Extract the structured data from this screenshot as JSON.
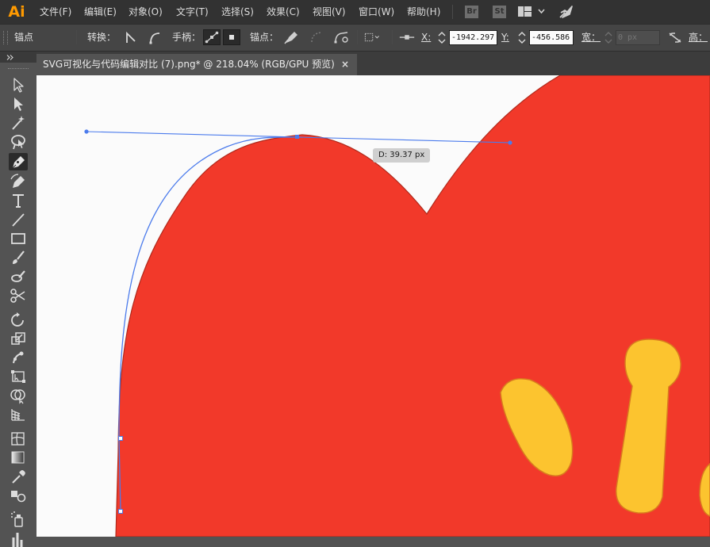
{
  "app": {
    "logo": "Ai"
  },
  "menu": {
    "items": [
      "文件(F)",
      "编辑(E)",
      "对象(O)",
      "文字(T)",
      "选择(S)",
      "效果(C)",
      "视图(V)",
      "窗口(W)",
      "帮助(H)"
    ],
    "bridge_label": "Br",
    "stock_label": "St",
    "accent_color": "#ff9a00"
  },
  "control_bar": {
    "anchor_section_label": "锚点",
    "convert_label": "转换：",
    "handles_label": "手柄：",
    "anchors_label": "锚点：",
    "x_label": "X:",
    "x_value": "-1942.297",
    "y_label": "Y:",
    "y_value": "-456.586",
    "width_label": "宽：",
    "width_value": "0 px",
    "height_label": "高："
  },
  "document": {
    "tab_title": "SVG可视化与代码编辑对比 (7).png* @ 218.04% (RGB/GPU 预览)",
    "close_glyph": "×"
  },
  "canvas": {
    "distance_tooltip": "D: 39.37 px",
    "path_color": "#4b7bec",
    "shape_fill": "#f2392a",
    "accent_fill": "#fcc42f"
  },
  "tools": [
    "selection-tool",
    "direct-selection-tool",
    "magic-wand-tool",
    "lasso-tool",
    "pen-tool",
    "curvature-tool",
    "type-tool",
    "line-segment-tool",
    "rectangle-tool",
    "paintbrush-tool",
    "shaper-tool",
    "scissors-tool",
    "rotate-tool",
    "scale-tool",
    "puppet-warp-tool",
    "free-transform-tool",
    "shape-builder-tool",
    "perspective-grid-tool",
    "mesh-tool",
    "gradient-tool",
    "eyedropper-tool",
    "blend-tool",
    "symbol-sprayer-tool",
    "column-graph-tool"
  ]
}
